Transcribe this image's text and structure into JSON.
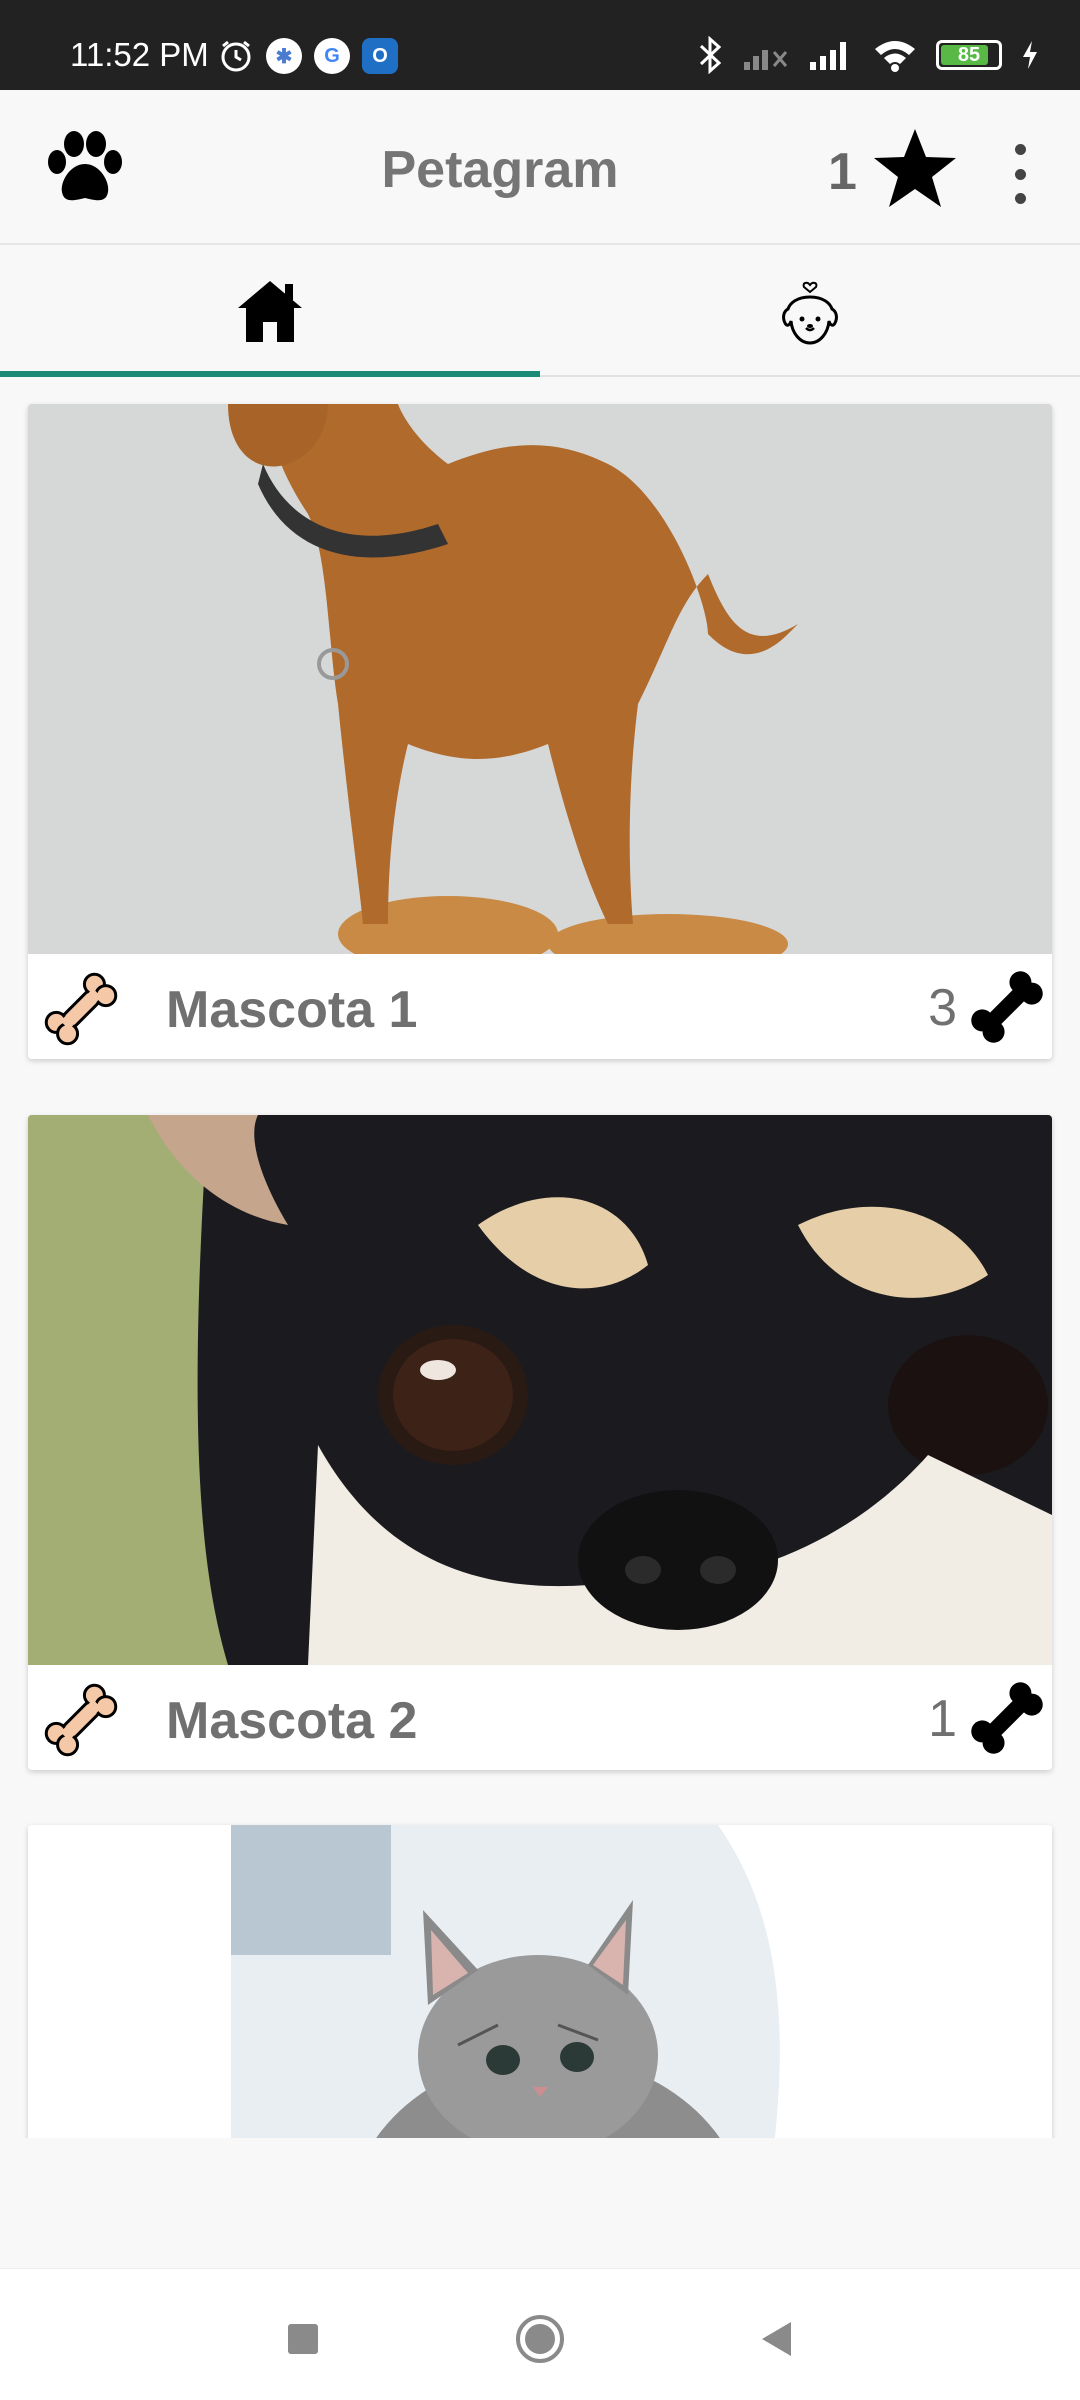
{
  "status_bar": {
    "time": "11:52 PM",
    "battery": "85",
    "battery_level": 0.85
  },
  "app_bar": {
    "title": "Petagram",
    "favorites_count": "1",
    "logo_icon": "paw-icon",
    "favorites_icon": "star-icon",
    "menu_icon": "more-vert-icon"
  },
  "tabs": [
    {
      "icon": "home-icon",
      "selected": true
    },
    {
      "icon": "dog-profile-icon",
      "selected": false
    }
  ],
  "pets": [
    {
      "name": "Mascota 1",
      "likes": "3"
    },
    {
      "name": "Mascota 2",
      "likes": "1"
    },
    {
      "name": "",
      "likes": ""
    }
  ],
  "colors": {
    "accent": "#1b8b78",
    "bone_fill": "#f5c8a8",
    "text": "#707070"
  }
}
